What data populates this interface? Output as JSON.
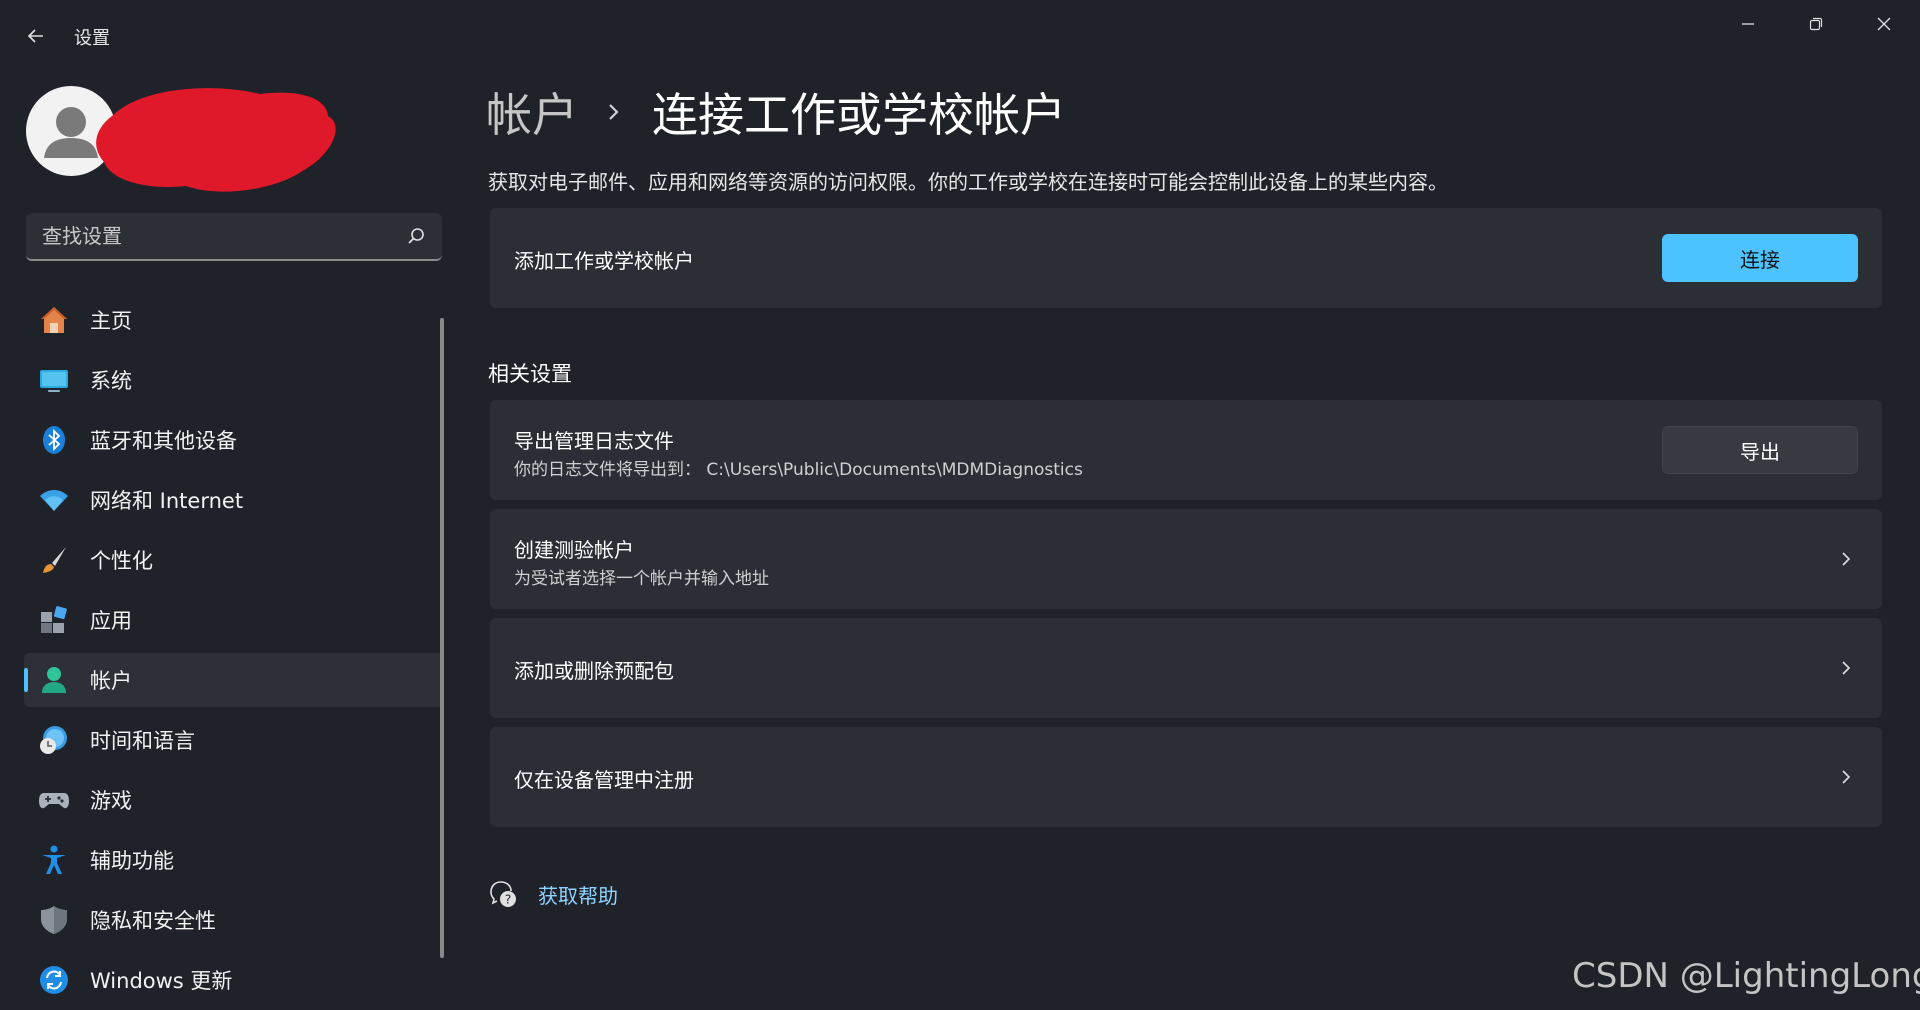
{
  "window": {
    "title": "设置",
    "controls": {
      "minimize": "minimize-icon",
      "maximize": "restore-icon",
      "close": "close-icon"
    }
  },
  "search": {
    "placeholder": "查找设置"
  },
  "sidebar": {
    "items": [
      {
        "label": "主页",
        "icon": "home-icon"
      },
      {
        "label": "系统",
        "icon": "system-icon"
      },
      {
        "label": "蓝牙和其他设备",
        "icon": "bluetooth-icon"
      },
      {
        "label": "网络和 Internet",
        "icon": "wifi-icon"
      },
      {
        "label": "个性化",
        "icon": "brush-icon"
      },
      {
        "label": "应用",
        "icon": "apps-icon"
      },
      {
        "label": "帐户",
        "icon": "account-icon",
        "active": true
      },
      {
        "label": "时间和语言",
        "icon": "time-language-icon"
      },
      {
        "label": "游戏",
        "icon": "gamepad-icon"
      },
      {
        "label": "辅助功能",
        "icon": "accessibility-icon"
      },
      {
        "label": "隐私和安全性",
        "icon": "shield-icon"
      },
      {
        "label": "Windows 更新",
        "icon": "update-icon"
      }
    ]
  },
  "main": {
    "breadcrumb": {
      "parent": "帐户",
      "current": "连接工作或学校帐户"
    },
    "description": "获取对电子邮件、应用和网络等资源的访问权限。你的工作或学校在连接时可能会控制此设备上的某些内容。",
    "add_account": {
      "title": "添加工作或学校帐户",
      "button": "连接"
    },
    "related_title": "相关设置",
    "related": [
      {
        "title": "导出管理日志文件",
        "subtitle": "你的日志文件将导出到： C:\\Users\\Public\\Documents\\MDMDiagnostics",
        "button": "导出"
      },
      {
        "title": "创建测验帐户",
        "subtitle": "为受试者选择一个帐户并输入地址"
      },
      {
        "title": "添加或删除预配包",
        "subtitle": ""
      },
      {
        "title": "仅在设备管理中注册",
        "subtitle": ""
      }
    ],
    "help": "获取帮助"
  },
  "watermark": "CSDN @LightingLong",
  "colors": {
    "accent": "#4cc2ff",
    "background": "#1f2228",
    "card": "#2b2e35",
    "redaction": "#e0192a"
  }
}
